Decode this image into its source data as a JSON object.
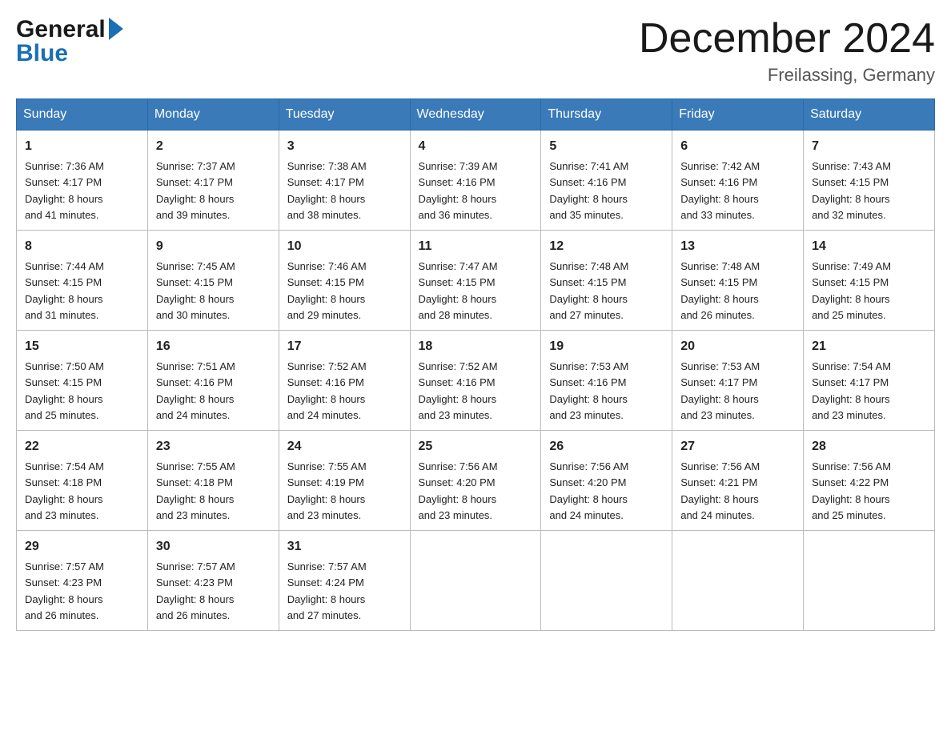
{
  "logo": {
    "general": "General",
    "blue": "Blue"
  },
  "title": "December 2024",
  "subtitle": "Freilassing, Germany",
  "days_of_week": [
    "Sunday",
    "Monday",
    "Tuesday",
    "Wednesday",
    "Thursday",
    "Friday",
    "Saturday"
  ],
  "weeks": [
    [
      {
        "day": "1",
        "sunrise": "7:36 AM",
        "sunset": "4:17 PM",
        "daylight": "8 hours and 41 minutes."
      },
      {
        "day": "2",
        "sunrise": "7:37 AM",
        "sunset": "4:17 PM",
        "daylight": "8 hours and 39 minutes."
      },
      {
        "day": "3",
        "sunrise": "7:38 AM",
        "sunset": "4:17 PM",
        "daylight": "8 hours and 38 minutes."
      },
      {
        "day": "4",
        "sunrise": "7:39 AM",
        "sunset": "4:16 PM",
        "daylight": "8 hours and 36 minutes."
      },
      {
        "day": "5",
        "sunrise": "7:41 AM",
        "sunset": "4:16 PM",
        "daylight": "8 hours and 35 minutes."
      },
      {
        "day": "6",
        "sunrise": "7:42 AM",
        "sunset": "4:16 PM",
        "daylight": "8 hours and 33 minutes."
      },
      {
        "day": "7",
        "sunrise": "7:43 AM",
        "sunset": "4:15 PM",
        "daylight": "8 hours and 32 minutes."
      }
    ],
    [
      {
        "day": "8",
        "sunrise": "7:44 AM",
        "sunset": "4:15 PM",
        "daylight": "8 hours and 31 minutes."
      },
      {
        "day": "9",
        "sunrise": "7:45 AM",
        "sunset": "4:15 PM",
        "daylight": "8 hours and 30 minutes."
      },
      {
        "day": "10",
        "sunrise": "7:46 AM",
        "sunset": "4:15 PM",
        "daylight": "8 hours and 29 minutes."
      },
      {
        "day": "11",
        "sunrise": "7:47 AM",
        "sunset": "4:15 PM",
        "daylight": "8 hours and 28 minutes."
      },
      {
        "day": "12",
        "sunrise": "7:48 AM",
        "sunset": "4:15 PM",
        "daylight": "8 hours and 27 minutes."
      },
      {
        "day": "13",
        "sunrise": "7:48 AM",
        "sunset": "4:15 PM",
        "daylight": "8 hours and 26 minutes."
      },
      {
        "day": "14",
        "sunrise": "7:49 AM",
        "sunset": "4:15 PM",
        "daylight": "8 hours and 25 minutes."
      }
    ],
    [
      {
        "day": "15",
        "sunrise": "7:50 AM",
        "sunset": "4:15 PM",
        "daylight": "8 hours and 25 minutes."
      },
      {
        "day": "16",
        "sunrise": "7:51 AM",
        "sunset": "4:16 PM",
        "daylight": "8 hours and 24 minutes."
      },
      {
        "day": "17",
        "sunrise": "7:52 AM",
        "sunset": "4:16 PM",
        "daylight": "8 hours and 24 minutes."
      },
      {
        "day": "18",
        "sunrise": "7:52 AM",
        "sunset": "4:16 PM",
        "daylight": "8 hours and 23 minutes."
      },
      {
        "day": "19",
        "sunrise": "7:53 AM",
        "sunset": "4:16 PM",
        "daylight": "8 hours and 23 minutes."
      },
      {
        "day": "20",
        "sunrise": "7:53 AM",
        "sunset": "4:17 PM",
        "daylight": "8 hours and 23 minutes."
      },
      {
        "day": "21",
        "sunrise": "7:54 AM",
        "sunset": "4:17 PM",
        "daylight": "8 hours and 23 minutes."
      }
    ],
    [
      {
        "day": "22",
        "sunrise": "7:54 AM",
        "sunset": "4:18 PM",
        "daylight": "8 hours and 23 minutes."
      },
      {
        "day": "23",
        "sunrise": "7:55 AM",
        "sunset": "4:18 PM",
        "daylight": "8 hours and 23 minutes."
      },
      {
        "day": "24",
        "sunrise": "7:55 AM",
        "sunset": "4:19 PM",
        "daylight": "8 hours and 23 minutes."
      },
      {
        "day": "25",
        "sunrise": "7:56 AM",
        "sunset": "4:20 PM",
        "daylight": "8 hours and 23 minutes."
      },
      {
        "day": "26",
        "sunrise": "7:56 AM",
        "sunset": "4:20 PM",
        "daylight": "8 hours and 24 minutes."
      },
      {
        "day": "27",
        "sunrise": "7:56 AM",
        "sunset": "4:21 PM",
        "daylight": "8 hours and 24 minutes."
      },
      {
        "day": "28",
        "sunrise": "7:56 AM",
        "sunset": "4:22 PM",
        "daylight": "8 hours and 25 minutes."
      }
    ],
    [
      {
        "day": "29",
        "sunrise": "7:57 AM",
        "sunset": "4:23 PM",
        "daylight": "8 hours and 26 minutes."
      },
      {
        "day": "30",
        "sunrise": "7:57 AM",
        "sunset": "4:23 PM",
        "daylight": "8 hours and 26 minutes."
      },
      {
        "day": "31",
        "sunrise": "7:57 AM",
        "sunset": "4:24 PM",
        "daylight": "8 hours and 27 minutes."
      },
      null,
      null,
      null,
      null
    ]
  ],
  "labels": {
    "sunrise": "Sunrise: ",
    "sunset": "Sunset: ",
    "daylight": "Daylight: "
  }
}
